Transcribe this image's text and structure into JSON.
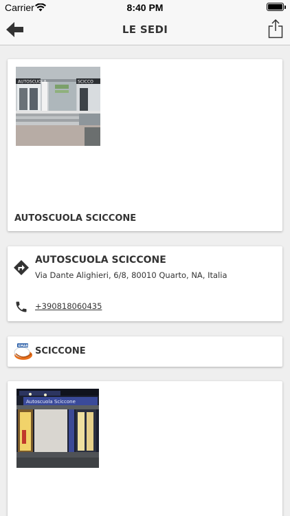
{
  "status_bar": {
    "carrier": "Carrier",
    "time": "8:40 PM",
    "wifi_icon": "wifi-icon",
    "battery_icon": "battery-icon"
  },
  "nav": {
    "title": "LE SEDI",
    "back_icon": "arrow-left-icon",
    "share_icon": "share-icon"
  },
  "location_card": {
    "caption": "AUTOSCUOLA SCICCONE",
    "photo_sign_left": "AUTOSCUOLA",
    "photo_sign_right": "SCICCO"
  },
  "contact_card": {
    "name": "AUTOSCUOLA SCICCONE",
    "address": "Via Dante Alighieri, 6/8, 80010 Quarto, NA, Italia",
    "phone": "+390818060435",
    "directions_icon": "directions-icon",
    "phone_icon": "phone-icon"
  },
  "brand_row": {
    "label": "SCICCONE",
    "logo_text": "EMAR"
  },
  "second_photo": {
    "sign_text": "Autoscuola Sciccone"
  },
  "colors": {
    "bar_bg": "#f7f7f7",
    "page_bg": "#efefef",
    "text": "#333333",
    "logo_orange": "#e8701c"
  }
}
